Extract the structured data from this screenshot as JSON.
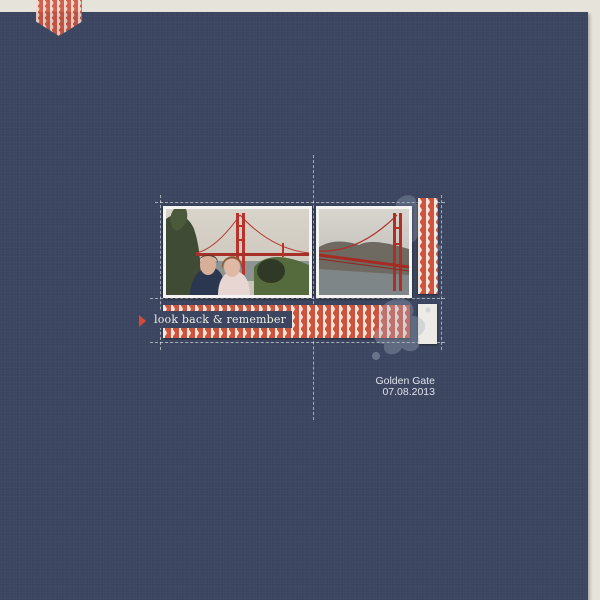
{
  "layout_title": "",
  "label": {
    "text": "look back & remember"
  },
  "caption": {
    "place": "Golden Gate",
    "date": "07.08.2013"
  },
  "photos": [
    {
      "name": "girls-at-golden-gate",
      "description_icon": "photo-two-girls-bridge"
    },
    {
      "name": "golden-gate-bridge",
      "description_icon": "photo-bridge"
    }
  ],
  "colors": {
    "background": "#3c4660",
    "accent": "#cf5440",
    "paper": "#f2e7dc",
    "page_edge": "#e6e4da"
  }
}
